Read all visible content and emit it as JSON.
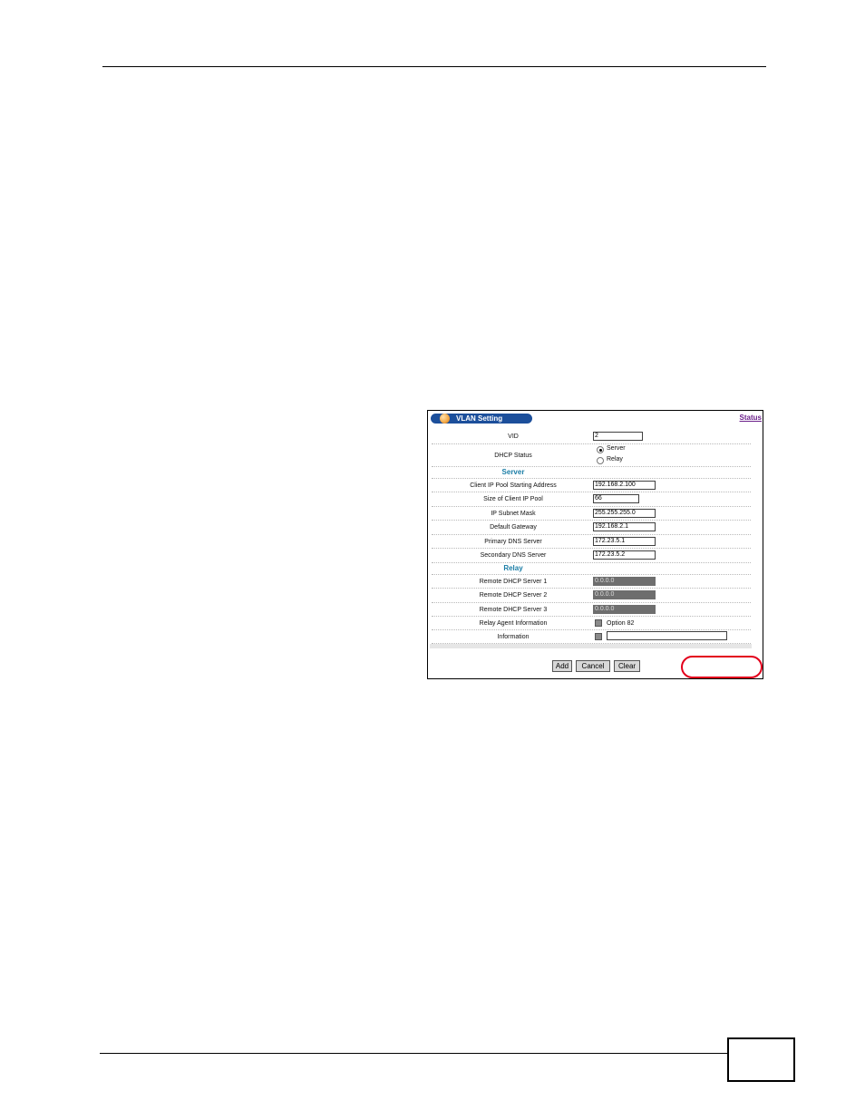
{
  "window": {
    "title": "VLAN Setting",
    "status_link": "Status"
  },
  "form": {
    "vid": {
      "label": "VID",
      "value": "2"
    },
    "dhcp_status": {
      "label": "DHCP Status",
      "options": [
        {
          "label": "Server",
          "selected": true
        },
        {
          "label": "Relay",
          "selected": false
        }
      ]
    },
    "server_section": {
      "heading": "Server",
      "fields": [
        {
          "label": "Client IP Pool Starting Address",
          "value": "192.168.2.100"
        },
        {
          "label": "Size of Client IP Pool",
          "value": "66"
        },
        {
          "label": "IP Subnet Mask",
          "value": "255.255.255.0"
        },
        {
          "label": "Default Gateway",
          "value": "192.168.2.1"
        },
        {
          "label": "Primary DNS Server",
          "value": "172.23.5.1"
        },
        {
          "label": "Secondary DNS Server",
          "value": "172.23.5.2"
        }
      ]
    },
    "relay_section": {
      "heading": "Relay",
      "fields": [
        {
          "label": "Remote DHCP Server 1",
          "value": "0.0.0.0"
        },
        {
          "label": "Remote DHCP Server 2",
          "value": "0.0.0.0"
        },
        {
          "label": "Remote DHCP Server 3",
          "value": "0.0.0.0"
        }
      ],
      "relay_agent": {
        "label": "Relay Agent Information",
        "option_label": "Option 82"
      },
      "information": {
        "label": "Information",
        "value": ""
      }
    }
  },
  "buttons": {
    "add": "Add",
    "cancel": "Cancel",
    "clear": "Clear"
  },
  "colors": {
    "title_bar": "#1c4f9b",
    "section_heading": "#1a7da6",
    "status_link": "#6b1f8a",
    "highlight_oval": "#e3001b"
  }
}
